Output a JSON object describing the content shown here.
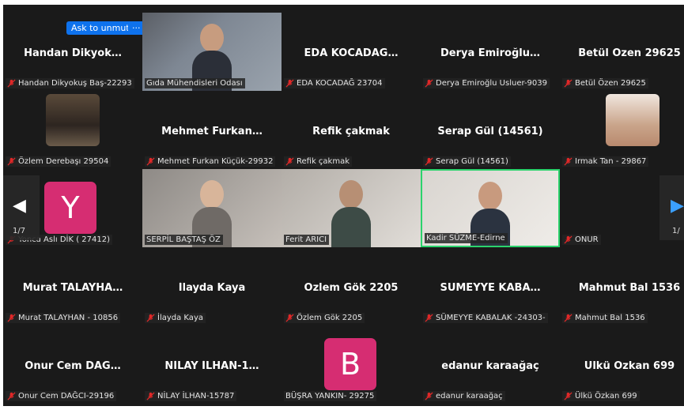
{
  "controls": {
    "ask_to_unmute": "Ask to unmute",
    "more": "···"
  },
  "pager": {
    "left": "1/7",
    "right": "1/"
  },
  "tiles": [
    {
      "display": "Handan  Dikyok…",
      "label": "Handan Dikyokuş Baş-22293"
    },
    {
      "display": "",
      "label": "Gıda Mühendisleri Odası"
    },
    {
      "display": "EDA  KOCADAĞ…",
      "label": "EDA KOCADAĞ 23704"
    },
    {
      "display": "Derya  Emiroğlu…",
      "label": "Derya Emiroğlu Usluer-9039"
    },
    {
      "display": "Betül Özen 29625",
      "label": "Betül Özen 29625"
    },
    {
      "display": "",
      "label": "Özlem Derebaşı 29504"
    },
    {
      "display": "Mehmet  Furkan…",
      "label": "Mehmet Furkan Küçük-29932"
    },
    {
      "display": "Refik çakmak",
      "label": "Refik çakmak"
    },
    {
      "display": "Serap Gül (14561)",
      "label": "Serap Gül (14561)"
    },
    {
      "display": "",
      "label": "Irmak Tan - 29867"
    },
    {
      "display": "",
      "avatar": "Y",
      "label": "Yonca Aslı DİK ( 27412)"
    },
    {
      "display": "",
      "label": "SERPİL BAŞTAŞ ÖZ"
    },
    {
      "display": "",
      "label": "Ferit ARICI"
    },
    {
      "display": "",
      "label": "Kadir SÜZME-Edirne"
    },
    {
      "display": "",
      "label": "ONUR"
    },
    {
      "display": "Murat  TALAYHA…",
      "label": "Murat TALAYHAN - 10856"
    },
    {
      "display": "İlayda Kaya",
      "label": "İlayda Kaya"
    },
    {
      "display": "Özlem Gök 2205",
      "label": "Özlem Gök 2205"
    },
    {
      "display": "SÜMEYYE  KABA…",
      "label": "SÜMEYYE KABALAK -24303-"
    },
    {
      "display": "Mahmut Bal 1536",
      "label": "Mahmut Bal 1536"
    },
    {
      "display": "Onur Cem  DAĞ…",
      "label": "Onur Cem DAĞCI-29196"
    },
    {
      "display": "NİLAY  İLHAN-1…",
      "label": "NİLAY İLHAN-15787"
    },
    {
      "display": "",
      "avatar": "B",
      "label": "BÜŞRA YANKIN- 29275"
    },
    {
      "display": "edanur karaağaç",
      "label": "edanur karaağaç"
    },
    {
      "display": "Ülkü Özkan 699",
      "label": "Ülkü Özkan 699"
    }
  ],
  "colors": {
    "muted_mic": "#e02828",
    "avatar_bg": "#d62d72",
    "active_speaker_border": "#2bd36c",
    "button_blue": "#0e72ed"
  }
}
